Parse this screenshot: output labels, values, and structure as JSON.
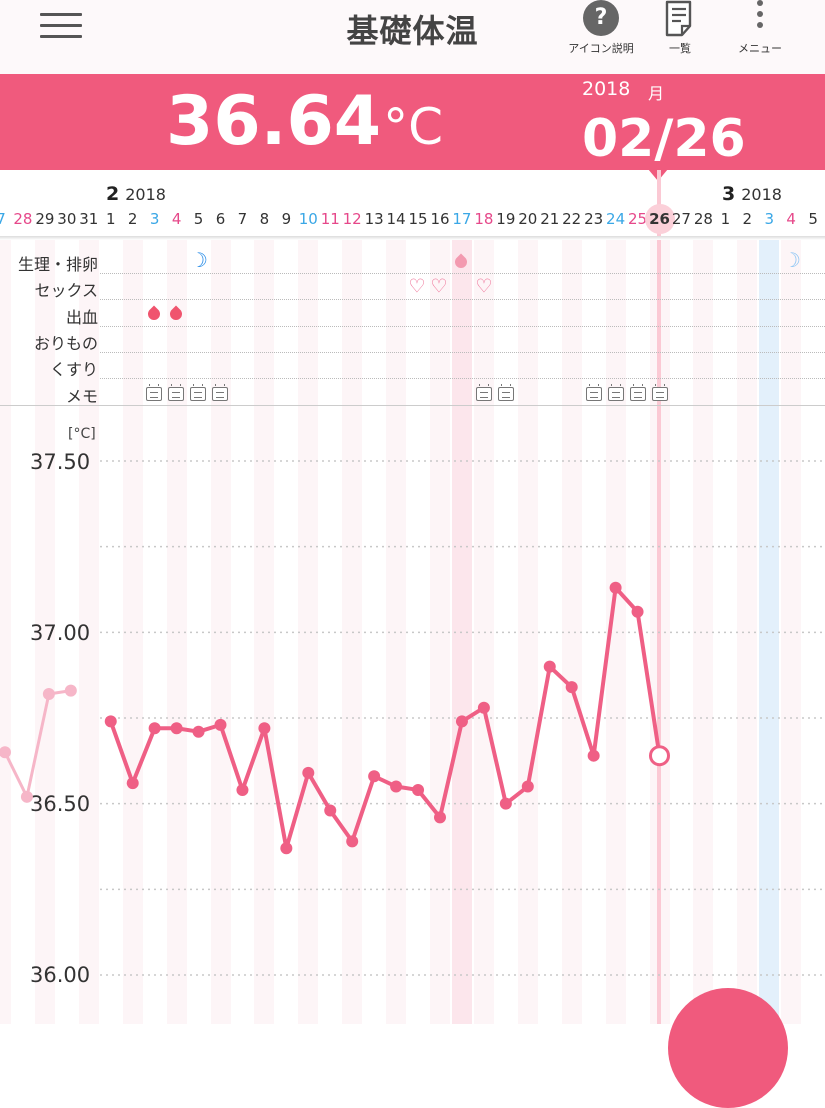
{
  "header": {
    "title": "基礎体温",
    "help_label": "アイコン説明",
    "help_icon_text": "?",
    "list_label": "一覧",
    "menu_label": "メニュー"
  },
  "banner": {
    "temperature": "36.64",
    "unit": "°C",
    "year": "2018",
    "month_label": "月",
    "date": "02/26"
  },
  "months": [
    {
      "month": "2",
      "year": "2018"
    },
    {
      "month": "3",
      "year": "2018"
    }
  ],
  "dates": [
    {
      "label": "7",
      "kind": "sat"
    },
    {
      "label": "28",
      "kind": "sun"
    },
    {
      "label": "29",
      "kind": ""
    },
    {
      "label": "30",
      "kind": ""
    },
    {
      "label": "31",
      "kind": ""
    },
    {
      "label": "1",
      "kind": ""
    },
    {
      "label": "2",
      "kind": ""
    },
    {
      "label": "3",
      "kind": "sat"
    },
    {
      "label": "4",
      "kind": "sun"
    },
    {
      "label": "5",
      "kind": ""
    },
    {
      "label": "6",
      "kind": ""
    },
    {
      "label": "7",
      "kind": ""
    },
    {
      "label": "8",
      "kind": ""
    },
    {
      "label": "9",
      "kind": ""
    },
    {
      "label": "10",
      "kind": "sat"
    },
    {
      "label": "11",
      "kind": "sun"
    },
    {
      "label": "12",
      "kind": "sun"
    },
    {
      "label": "13",
      "kind": ""
    },
    {
      "label": "14",
      "kind": ""
    },
    {
      "label": "15",
      "kind": ""
    },
    {
      "label": "16",
      "kind": ""
    },
    {
      "label": "17",
      "kind": "sat"
    },
    {
      "label": "18",
      "kind": "sun"
    },
    {
      "label": "19",
      "kind": ""
    },
    {
      "label": "20",
      "kind": ""
    },
    {
      "label": "21",
      "kind": ""
    },
    {
      "label": "22",
      "kind": ""
    },
    {
      "label": "23",
      "kind": ""
    },
    {
      "label": "24",
      "kind": "sat"
    },
    {
      "label": "25",
      "kind": "sun"
    },
    {
      "label": "26",
      "kind": "selected"
    },
    {
      "label": "27",
      "kind": ""
    },
    {
      "label": "28",
      "kind": ""
    },
    {
      "label": "1",
      "kind": ""
    },
    {
      "label": "2",
      "kind": ""
    },
    {
      "label": "3",
      "kind": "sat"
    },
    {
      "label": "4",
      "kind": "sun"
    },
    {
      "label": "5",
      "kind": ""
    }
  ],
  "categories": [
    "生理・排卵",
    "セックス",
    "出血",
    "おりもの",
    "くすり",
    "メモ"
  ],
  "colors": {
    "accent": "#f05a7d",
    "line": "#ef5f85",
    "saturday": "#3aa7e6",
    "sunday": "#e6488a"
  },
  "icons": [
    "hamburger-icon",
    "help-icon",
    "list-icon",
    "menu-dots-icon",
    "moon-icon",
    "drop-icon",
    "heart-icon",
    "memo-icon"
  ],
  "chart_data": {
    "type": "line",
    "ylabel": "[°C]",
    "yticks": [
      "37.50",
      "37.00",
      "36.50",
      "36.00"
    ],
    "ylim": [
      36.0,
      37.5
    ],
    "grid": true,
    "series": [
      {
        "x": [
          "1/27",
          "1/28",
          "1/29",
          "1/30"
        ],
        "values": [
          36.65,
          36.52,
          36.82,
          36.83
        ]
      },
      {
        "x": [
          "2/1",
          "2/2",
          "2/3",
          "2/4",
          "2/5",
          "2/6",
          "2/7",
          "2/8",
          "2/9",
          "2/10",
          "2/11",
          "2/12",
          "2/13",
          "2/14",
          "2/15",
          "2/16",
          "2/17",
          "2/18",
          "2/19",
          "2/20",
          "2/21",
          "2/22",
          "2/23",
          "2/24",
          "2/25",
          "2/26"
        ],
        "values": [
          36.74,
          36.56,
          36.72,
          36.72,
          36.71,
          36.73,
          36.54,
          36.72,
          36.37,
          36.59,
          36.48,
          36.39,
          36.58,
          36.55,
          36.54,
          36.46,
          36.74,
          36.78,
          36.5,
          36.55,
          36.9,
          36.84,
          36.64,
          37.13,
          37.06,
          36.64
        ]
      }
    ]
  }
}
